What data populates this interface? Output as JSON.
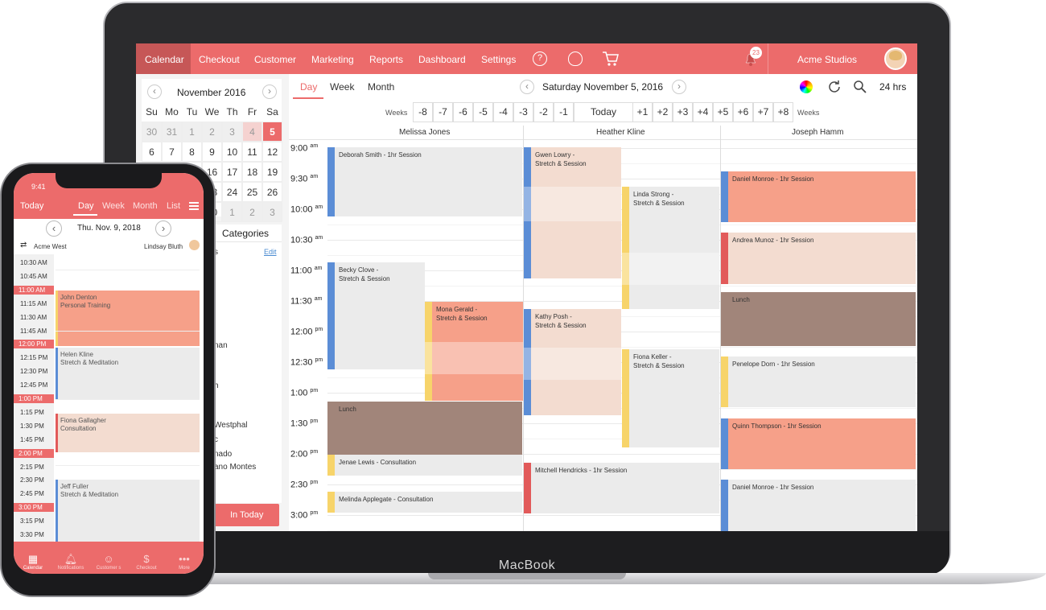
{
  "nav": {
    "items": [
      "Calendar",
      "Checkout",
      "Customer",
      "Marketing",
      "Reports",
      "Dashboard",
      "Settings"
    ],
    "help": "?",
    "notifications_count": "23",
    "studio": "Acme Studios"
  },
  "minical": {
    "month": "November 2016",
    "weekdays": [
      "Su",
      "Mo",
      "Tu",
      "We",
      "Th",
      "Fr",
      "Sa"
    ],
    "rows": [
      [
        "30",
        "31",
        "1",
        "2",
        "3",
        "4",
        "5"
      ],
      [
        "6",
        "7",
        "8",
        "9",
        "10",
        "11",
        "12"
      ],
      [
        "13",
        "14",
        "15",
        "16",
        "17",
        "18",
        "19"
      ],
      [
        "20",
        "21",
        "22",
        "23",
        "24",
        "25",
        "26"
      ],
      [
        "27",
        "28",
        "29",
        "30",
        "1",
        "2",
        "3"
      ]
    ],
    "selected": "5",
    "prev_icon": "‹",
    "next_icon": "›"
  },
  "sidebar": {
    "categories_label": "Categories",
    "edit": "Edit",
    "fragments": [
      "s",
      "nan",
      "",
      "h",
      "",
      "Westphal",
      "c",
      "nado",
      "ano Montes"
    ],
    "today_button": "In Today"
  },
  "view_tabs": [
    "Day",
    "Week",
    "Month"
  ],
  "date_title": "Saturday November 5, 2016",
  "hours_label": "24 hrs",
  "weeks": {
    "label": "Weeks",
    "back": [
      "-8",
      "-7",
      "-6",
      "-5",
      "-4",
      "-3",
      "-2",
      "-1"
    ],
    "today": "Today",
    "forward": [
      "+1",
      "+2",
      "+3",
      "+4",
      "+5",
      "+6",
      "+7",
      "+8"
    ]
  },
  "staff": [
    "Melissa Jones",
    "Heather Kline",
    "Joseph Hamm"
  ],
  "times": [
    {
      "t": "9:00",
      "ap": "am"
    },
    {
      "t": "9:30",
      "ap": "am"
    },
    {
      "t": "10:00",
      "ap": "am"
    },
    {
      "t": "10:30",
      "ap": "am"
    },
    {
      "t": "11:00",
      "ap": "am"
    },
    {
      "t": "11:30",
      "ap": "am"
    },
    {
      "t": "12:00",
      "ap": "pm"
    },
    {
      "t": "12:30",
      "ap": "pm"
    },
    {
      "t": "1:00",
      "ap": "pm"
    },
    {
      "t": "1:30",
      "ap": "pm"
    },
    {
      "t": "2:00",
      "ap": "pm"
    },
    {
      "t": "2:30",
      "ap": "pm"
    },
    {
      "t": "3:00",
      "ap": "pm"
    }
  ],
  "events": [
    {
      "name": "Deborah Smith - 1hr Session",
      "l1": "Deborah Smith - 1hr Session",
      "l2": ""
    },
    {
      "name": "Becky Clove",
      "l1": "Becky Clove -",
      "l2": "Stretch & Session"
    },
    {
      "name": "Mona Gerald",
      "l1": "Mona Gerald -",
      "l2": "Stretch & Session"
    },
    {
      "name": "Lunch",
      "l1": "Lunch",
      "l2": ""
    },
    {
      "name": "Jenae Lewis",
      "l1": "Jenae Lewis - Consultation",
      "l2": ""
    },
    {
      "name": "Melinda Applegate",
      "l1": "Melinda Applegate - Consultation",
      "l2": ""
    },
    {
      "name": "Gwen Lowry",
      "l1": "Gwen Lowry -",
      "l2": "Stretch & Session"
    },
    {
      "name": "Linda Strong",
      "l1": "Linda Strong -",
      "l2": "Stretch & Session"
    },
    {
      "name": "Kathy Posh",
      "l1": "Kathy Posh -",
      "l2": "Stretch & Session"
    },
    {
      "name": "Fiona Keller",
      "l1": "Fiona Keller -",
      "l2": "Stretch & Session"
    },
    {
      "name": "Mitchell Hendricks",
      "l1": "Mitchell Hendricks - 1hr Session",
      "l2": ""
    },
    {
      "name": "Daniel Monroe",
      "l1": "Daniel Monroe - 1hr Session",
      "l2": ""
    },
    {
      "name": "Andrea Munoz",
      "l1": "Andrea Munoz - 1hr Session",
      "l2": ""
    },
    {
      "name": "Lunch 2",
      "l1": "Lunch",
      "l2": ""
    },
    {
      "name": "Penelope Dorn",
      "l1": "Penelope Dorn - 1hr Session",
      "l2": ""
    },
    {
      "name": "Quinn Thompson",
      "l1": "Quinn Thompson - 1hr Session",
      "l2": ""
    },
    {
      "name": "Daniel Monroe 2",
      "l1": "Daniel Monroe - 1hr Session",
      "l2": ""
    }
  ],
  "laptop_brand": "MacBook",
  "phone": {
    "clock": "9:41",
    "today": "Today",
    "tabs": [
      "Day",
      "Week",
      "Month",
      "List"
    ],
    "date": "Thu. Nov. 9, 2018",
    "location": "Acme West",
    "staff": "Lindsay Bluth",
    "times": [
      "10:30 AM",
      "10:45 AM",
      "11:00 AM",
      "11:15 AM",
      "11:30 AM",
      "11:45 AM",
      "12:00 PM",
      "12:15 PM",
      "12:30 PM",
      "12:45 PM",
      "1:00 PM",
      "1:15 PM",
      "1:30 PM",
      "1:45 PM",
      "2:00 PM",
      "2:15 PM",
      "2:30 PM",
      "2:45 PM",
      "3:00 PM",
      "3:15 PM",
      "3:30 PM"
    ],
    "events": [
      {
        "l1": "John Denton",
        "l2": "Personal Training"
      },
      {
        "l1": "Helen Kline",
        "l2": "Stretch & Meditation"
      },
      {
        "l1": "Fiona Gallagher",
        "l2": "Consultation"
      },
      {
        "l1": "Jeff Fuller",
        "l2": "Stretch & Meditation"
      }
    ],
    "bottom_tabs": [
      "Calendar",
      "Notifications",
      "Customer s",
      "Checkout",
      "More"
    ]
  },
  "colors": {
    "brand": "#ec6b6b",
    "brand_dark": "#c65757",
    "blue": "#5b8dd6",
    "yellow": "#f7d46a",
    "red": "#e25a5a",
    "salmon": "#f6a089",
    "peach": "#f3dcd0",
    "brown": "#a1857a",
    "gray": "#ebebeb"
  }
}
